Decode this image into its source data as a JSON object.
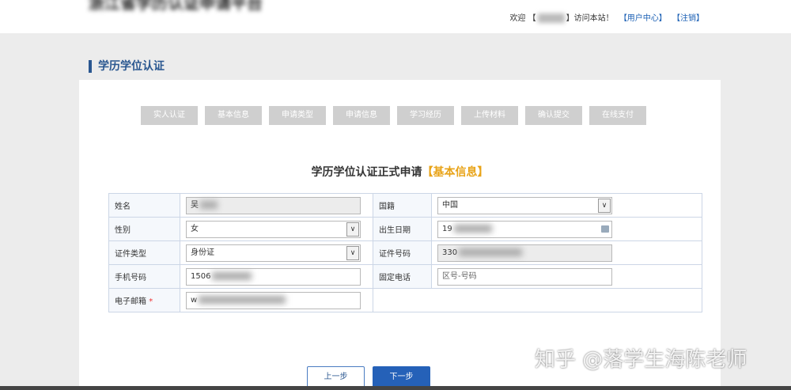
{
  "header": {
    "title_blurred": "浙江省学历认证申请平台",
    "welcome_prefix": "欢迎",
    "welcome_bracket_l": "【",
    "welcome_suffix": "】访问本站！",
    "user_center": "【用户中心】",
    "logout": "【注销】"
  },
  "section_title": "学历学位认证",
  "steps": [
    "实人认证",
    "基本信息",
    "申请类型",
    "申请信息",
    "学习经历",
    "上传材料",
    "确认提交",
    "在线支付"
  ],
  "form_title": "学历学位认证正式申请",
  "form_title_hl": "【基本信息】",
  "fields": {
    "name_label": "姓名",
    "name_value": "吴",
    "nationality_label": "国籍",
    "nationality_value": "中国",
    "gender_label": "性别",
    "gender_value": "女",
    "birth_label": "出生日期",
    "birth_value": "19",
    "idtype_label": "证件类型",
    "idtype_value": "身份证",
    "idnum_label": "证件号码",
    "idnum_value": "330",
    "phone_label": "手机号码",
    "phone_value": "1506",
    "tel_label": "固定电话",
    "tel_placeholder": "区号-号码",
    "email_label": "电子邮箱",
    "email_required": "*",
    "email_value": "w"
  },
  "buttons": {
    "prev": "上一步",
    "next": "下一步"
  },
  "watermark": "知乎 @落学生海陈老师"
}
